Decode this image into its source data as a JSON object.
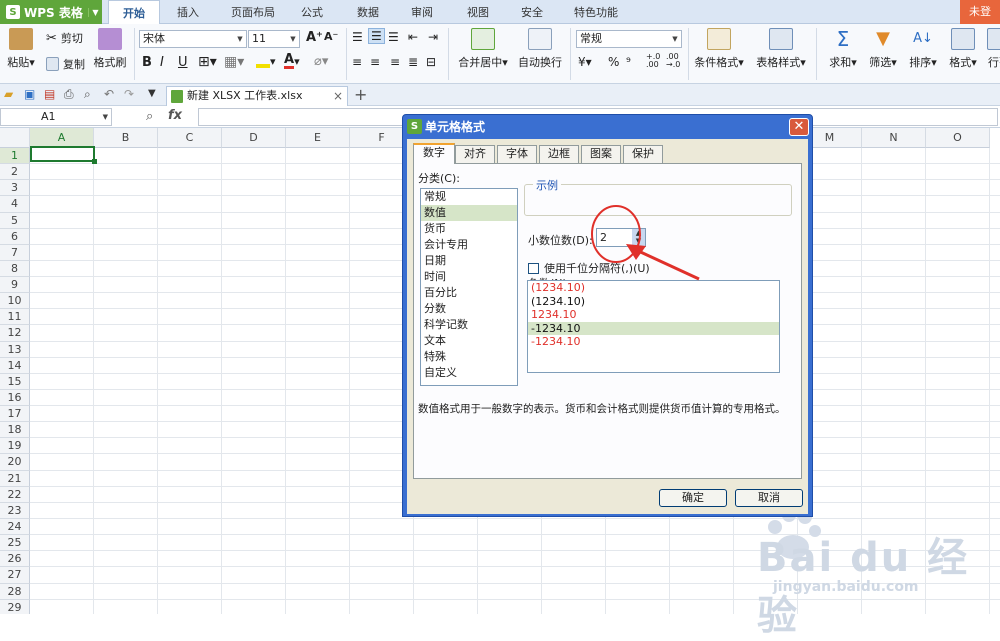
{
  "app": {
    "name": "WPS 表格",
    "login": "未登"
  },
  "menu_tabs": [
    "开始",
    "插入",
    "页面布局",
    "公式",
    "数据",
    "审阅",
    "视图",
    "安全",
    "特色功能"
  ],
  "ribbon": {
    "paste": "粘贴",
    "cut": "剪切",
    "copy": "复制",
    "format_painter": "格式刷",
    "font_name": "宋体",
    "font_size": "11",
    "merge_center": "合并居中",
    "wrap_text": "自动换行",
    "number_format": "常规",
    "conditional_format": "条件格式",
    "table_style": "表格样式",
    "sum": "求和",
    "filter": "筛选",
    "sort": "排序",
    "format": "格式",
    "rows_cols": "行列"
  },
  "doc_tab": "新建 XLSX 工作表.xlsx",
  "name_box": "A1",
  "fx": "fx",
  "columns": [
    "A",
    "B",
    "C",
    "D",
    "E",
    "F",
    "G",
    "H",
    "I",
    "J",
    "K",
    "L",
    "M",
    "N",
    "O"
  ],
  "rows": [
    "1",
    "2",
    "3",
    "4",
    "5",
    "6",
    "7",
    "8",
    "9",
    "10",
    "11",
    "12",
    "13",
    "14",
    "15",
    "16",
    "17",
    "18",
    "19",
    "20",
    "21",
    "22",
    "23",
    "24",
    "25",
    "26",
    "27",
    "28",
    "29"
  ],
  "dialog": {
    "title": "单元格格式",
    "tabs": [
      "数字",
      "对齐",
      "字体",
      "边框",
      "图案",
      "保护"
    ],
    "category_label": "分类(C):",
    "categories": [
      "常规",
      "数值",
      "货币",
      "会计专用",
      "日期",
      "时间",
      "百分比",
      "分数",
      "科学记数",
      "文本",
      "特殊",
      "自定义"
    ],
    "selected_category": "数值",
    "sample_label": "示例",
    "decimal_label": "小数位数(D):",
    "decimal_value": "2",
    "thousands_label": "使用千位分隔符(,)(U)",
    "negative_label": "负数(N):",
    "negatives": [
      {
        "text": "(1234.10)",
        "color": "#e0302a"
      },
      {
        "text": "(1234.10)",
        "color": "#111111"
      },
      {
        "text": "1234.10",
        "color": "#e0302a"
      },
      {
        "text": "-1234.10",
        "color": "#111111"
      },
      {
        "text": "-1234.10",
        "color": "#e0302a"
      }
    ],
    "description": "数值格式用于一般数字的表示。货币和会计格式则提供货币值计算的专用格式。",
    "ok": "确定",
    "cancel": "取消"
  },
  "watermark": {
    "brand": "Bai du 经验",
    "url": "jingyan.baidu.com"
  },
  "colors": {
    "accent_green": "#5fa63b",
    "dialog_blue": "#3a6fd1",
    "annotation_red": "#e0302a"
  }
}
